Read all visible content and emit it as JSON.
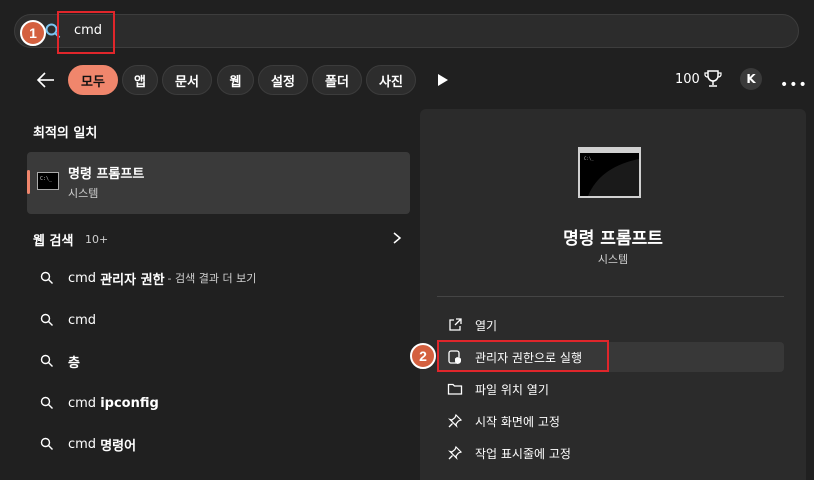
{
  "search": {
    "query": "cmd"
  },
  "annotations": {
    "step1": "1",
    "step2": "2",
    "highlight_color": "#e0262b",
    "badge_color": "#d4603f"
  },
  "filters": {
    "tabs": [
      "모두",
      "앱",
      "문서",
      "웹",
      "설정",
      "폴더",
      "사진"
    ],
    "active_index": 0
  },
  "header_right": {
    "points": "100",
    "avatar_initial": "K"
  },
  "best_match": {
    "heading": "최적의 일치",
    "name": "명령 프롬프트",
    "sub": "시스템"
  },
  "web_search": {
    "heading": "웹 검색",
    "count": "10+",
    "results": [
      {
        "prefix": "cmd ",
        "bold": "관리자 권한",
        "suffix": "- 검색 결과 더 보기"
      },
      {
        "prefix": "cmd",
        "bold": "",
        "suffix": ""
      },
      {
        "prefix": "",
        "bold": "층",
        "suffix": ""
      },
      {
        "prefix": "cmd ",
        "bold": "ipconfig",
        "suffix": ""
      },
      {
        "prefix": "cmd ",
        "bold": "명령어",
        "suffix": ""
      }
    ]
  },
  "detail": {
    "title": "명령 프롬프트",
    "sub": "시스템",
    "actions": [
      {
        "label": "열기",
        "icon": "open-external-icon"
      },
      {
        "label": "관리자 권한으로 실행",
        "icon": "shield-admin-icon"
      },
      {
        "label": "파일 위치 열기",
        "icon": "folder-icon"
      },
      {
        "label": "시작 화면에 고정",
        "icon": "pin-icon"
      },
      {
        "label": "작업 표시줄에 고정",
        "icon": "pin-icon"
      }
    ]
  },
  "colors": {
    "accent": "#f0866c",
    "background": "#202020",
    "panel": "#2b2b2b"
  }
}
